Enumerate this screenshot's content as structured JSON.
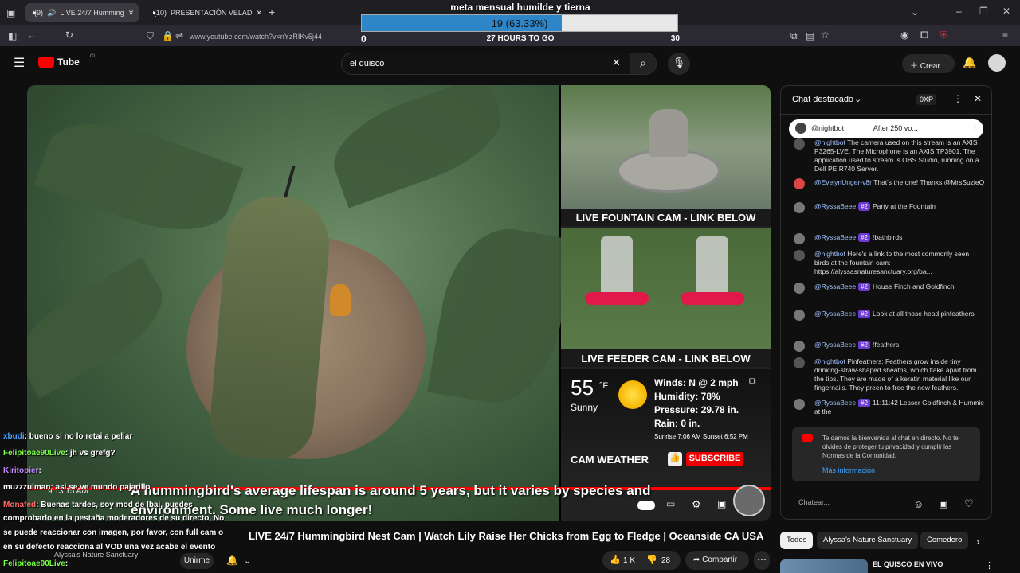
{
  "browser": {
    "tabs": [
      {
        "badge": "(9)",
        "label": "LIVE 24/7 Humming"
      },
      {
        "badge": "(10)",
        "label": "PRESENTACIÓN VELAD"
      }
    ],
    "new_tab": "+",
    "url": "www.youtube.com/watch?v=nYzRIKv5j44"
  },
  "goal": {
    "title": "meta mensual humilde y tierna",
    "count_text": "19 (63.33%)",
    "progress_fraction": 0.6333,
    "min": "0",
    "time_left": "27 HOURS TO GO",
    "max": "30"
  },
  "youtube": {
    "logo_text": "Tube",
    "country": "CL",
    "search_value": "el quisco",
    "create_label": "Crear"
  },
  "video": {
    "fountain_label": "LIVE FOUNTAIN CAM - LINK BELOW",
    "feeder_label": "LIVE FEEDER CAM - LINK BELOW",
    "weather": {
      "temp": "55",
      "unit": "°F",
      "condition": "Sunny",
      "winds": "Winds: N @ 2 mph",
      "humidity": "Humidity: 78%",
      "pressure": "Pressure: 29.78 in.",
      "rain": "Rain: 0 in.",
      "sun": "Sunrise 7:06 AM  Sunset 6:52 PM",
      "cam_label": "CAM WEATHER",
      "subscribe": "SUBSCRIBE"
    },
    "caption_line1": "A hummingbird's average lifespan is around 5 years, but it varies by species and",
    "caption_line2": "environment. Some live much longer!",
    "timestamp": "9:13:15 AM"
  },
  "overlay_chat": [
    {
      "name": "xbudi",
      "name_color": "#4aa3ff",
      "text": ": bueno si no lo retai a peliar"
    },
    {
      "name": "Felipitoae90Live",
      "name_color": "#7cff4a",
      "text": ": jh vs grefg?"
    },
    {
      "name": "Kiritopier",
      "name_color": "#c28cff",
      "text": ":"
    },
    {
      "name": "muzzzulman",
      "name_color": "#ffffff",
      "text": ": asi se ve mundo pajarillo"
    },
    {
      "name": "Monafed",
      "name_color": "#ff6b6b",
      "text": ": Buenas tardes, soy mod de Ibai, puedes"
    },
    {
      "name": "",
      "name_color": "#ffffff",
      "text": "comprobarlo en la pestaña moderadores de su directo, No"
    },
    {
      "name": "",
      "name_color": "#ffffff",
      "text": "se puede reaccionar con imagen, por favor, con full cam o"
    },
    {
      "name": "",
      "name_color": "#ffffff",
      "text": "en su defecto reacciona al VOD una vez acabe el evento"
    },
    {
      "name": "Felipitoae90Live",
      "name_color": "#7cff4a",
      "text": ":"
    }
  ],
  "below_video": {
    "title": "LIVE 24/7 Hummingbird Nest Cam | Watch Lily Raise Her Chicks from Egg to Fledge | Oceanside CA USA",
    "channel": "Alyssa's Nature Sanctuary",
    "join_label": "Unirme",
    "likes": "1 K",
    "dislikes": "28",
    "share_label": "Compartir"
  },
  "chat": {
    "header": "Chat destacado",
    "xp": "0XP",
    "pinned_author": "@nightbot",
    "pinned_text": "After 250 vo...",
    "messages": [
      {
        "author": "@nightbot",
        "badge": "",
        "text": "The camera used on this stream is an AXIS P3265-LVE. The Microphone is an AXIS TP3901. The application used to stream is OBS Studio, running on a Dell PE R740 Server."
      },
      {
        "author": "@EvelynUnger-v8r",
        "badge": "",
        "text": "That's the one! Thanks @MrsSuzieQ"
      },
      {
        "author": "@RyssaBeee",
        "badge": "#2",
        "text": "Party at the Fountain"
      },
      {
        "author": "@RyssaBeee",
        "badge": "#2",
        "text": "!bathbirds"
      },
      {
        "author": "@nightbot",
        "badge": "",
        "text": "Here's a link to the most commonly seen birds at the fountain cam: https://alyssasnaturesanctuary.org/ba..."
      },
      {
        "author": "@RyssaBeee",
        "badge": "#2",
        "text": "House Finch and Goldfinch"
      },
      {
        "author": "@RyssaBeee",
        "badge": "#2",
        "text": "Look at all those head pinfeathers"
      },
      {
        "author": "@RyssaBeee",
        "badge": "#2",
        "text": "!feathers"
      },
      {
        "author": "@nightbot",
        "badge": "",
        "text": "Pinfeathers: Feathers grow inside tiny drinking-straw-shaped sheaths, which flake apart from the tips. They are made of a keratin material like our fingernails. They preen to free the new feathers."
      },
      {
        "author": "@RyssaBeee",
        "badge": "#2",
        "text": "11:11:42 Lesser Goldfinch & Hummie at the"
      }
    ],
    "welcome_text": "Te damos la bienvenida al chat en directo. No te olvides de proteger tu privacidad y cumplir las Normas de la Comunidad.",
    "more_info": "Más información",
    "input_placeholder": "Chatear..."
  },
  "chips": [
    "Todos",
    "Alyssa's Nature Sanctuary",
    "Comedero"
  ],
  "recommendation": {
    "title": "EL QUISCO EN VIVO"
  }
}
